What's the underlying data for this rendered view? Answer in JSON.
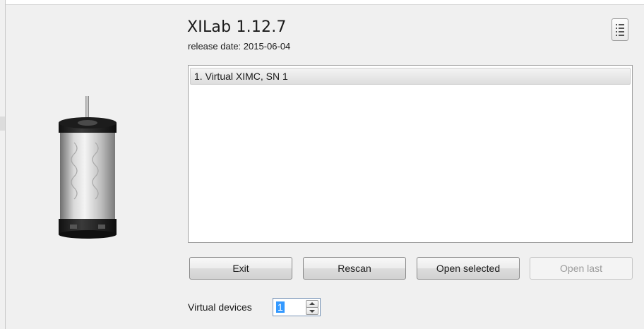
{
  "app": {
    "title": "XILab 1.12.7",
    "release_date": "release date: 2015-06-04"
  },
  "icons": {
    "device_image": "motor-device-icon",
    "log": "log-list-icon"
  },
  "device_list": {
    "items": [
      {
        "label": "1. Virtual XIMC, SN 1",
        "selected": true
      }
    ]
  },
  "buttons": {
    "exit": "Exit",
    "rescan": "Rescan",
    "open_selected": "Open selected",
    "open_last": "Open last"
  },
  "virtual_devices": {
    "label": "Virtual devices",
    "value": "1"
  },
  "colors": {
    "selection": "#3399ff",
    "window_bg": "#f0f0f0"
  }
}
